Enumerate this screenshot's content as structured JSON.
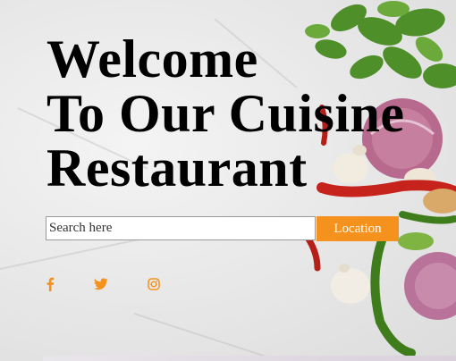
{
  "hero": {
    "title_lines": [
      "Welcome",
      "To Our Cuisine",
      "Restaurant"
    ]
  },
  "search": {
    "placeholder": "Search here",
    "button_label": "Location"
  },
  "social": {
    "icons": [
      "facebook-icon",
      "twitter-icon",
      "instagram-icon"
    ]
  },
  "colors": {
    "accent": "#f5921d",
    "background": "#ececec",
    "title": "#000000"
  }
}
